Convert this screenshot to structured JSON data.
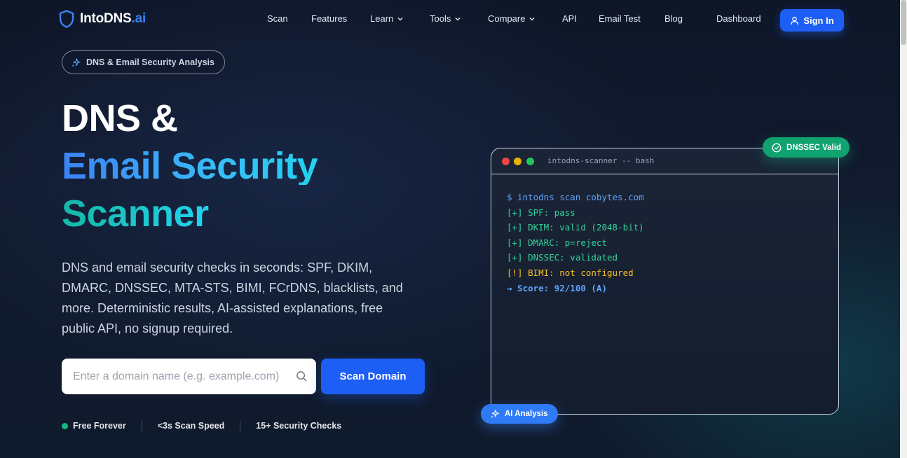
{
  "nav": {
    "brand_name": "IntoDNS",
    "brand_suffix": ".ai",
    "links": [
      {
        "label": "Scan",
        "icon": null
      },
      {
        "label": "Features",
        "icon": null
      },
      {
        "label": "Learn",
        "icon": "chevron-down-icon"
      },
      {
        "label": "Tools",
        "icon": "chevron-down-icon"
      },
      {
        "label": "Compare",
        "icon": "chevron-down-icon"
      },
      {
        "label": "API",
        "icon": null
      },
      {
        "label": "Email Test",
        "icon": null
      },
      {
        "label": "Blog",
        "icon": null
      },
      {
        "label": "Dashboard",
        "icon": null
      }
    ],
    "signin_label": "Sign In"
  },
  "hero": {
    "pill_label": "DNS & Email Security Analysis",
    "title_line1": "DNS &",
    "title_line2": "Email Security",
    "title_line3": "Scanner",
    "description": "DNS and email security checks in seconds: SPF, DKIM, DMARC, DNSSEC, MTA-STS, BIMI, FCrDNS, blacklists, and more. Deterministic results, AI-assisted explanations, free public API, no signup required.",
    "search_placeholder": "Enter a domain name (e.g. example.com)",
    "scan_button_label": "Scan Domain",
    "features": [
      "Free Forever",
      "<3s Scan Speed",
      "15+ Security Checks"
    ]
  },
  "terminal": {
    "title": "intodns-scanner -- bash",
    "lines": [
      "$ intodns scan cobytes.com",
      "[+] SPF: pass",
      "[+] DKIM: valid (2048-bit)",
      "[+] DMARC: p=reject",
      "[+] DNSSEC: validated",
      "[!] BIMI: not configured",
      "→ Score: 92/100 (A)"
    ],
    "badge_dnssec": "DNSSEC Valid",
    "badge_ai": "AI Analysis"
  },
  "colors": {
    "accent": "#1d5ff5",
    "success": "#10a36f",
    "warning": "#fbbf24",
    "background": "#0e1628"
  }
}
